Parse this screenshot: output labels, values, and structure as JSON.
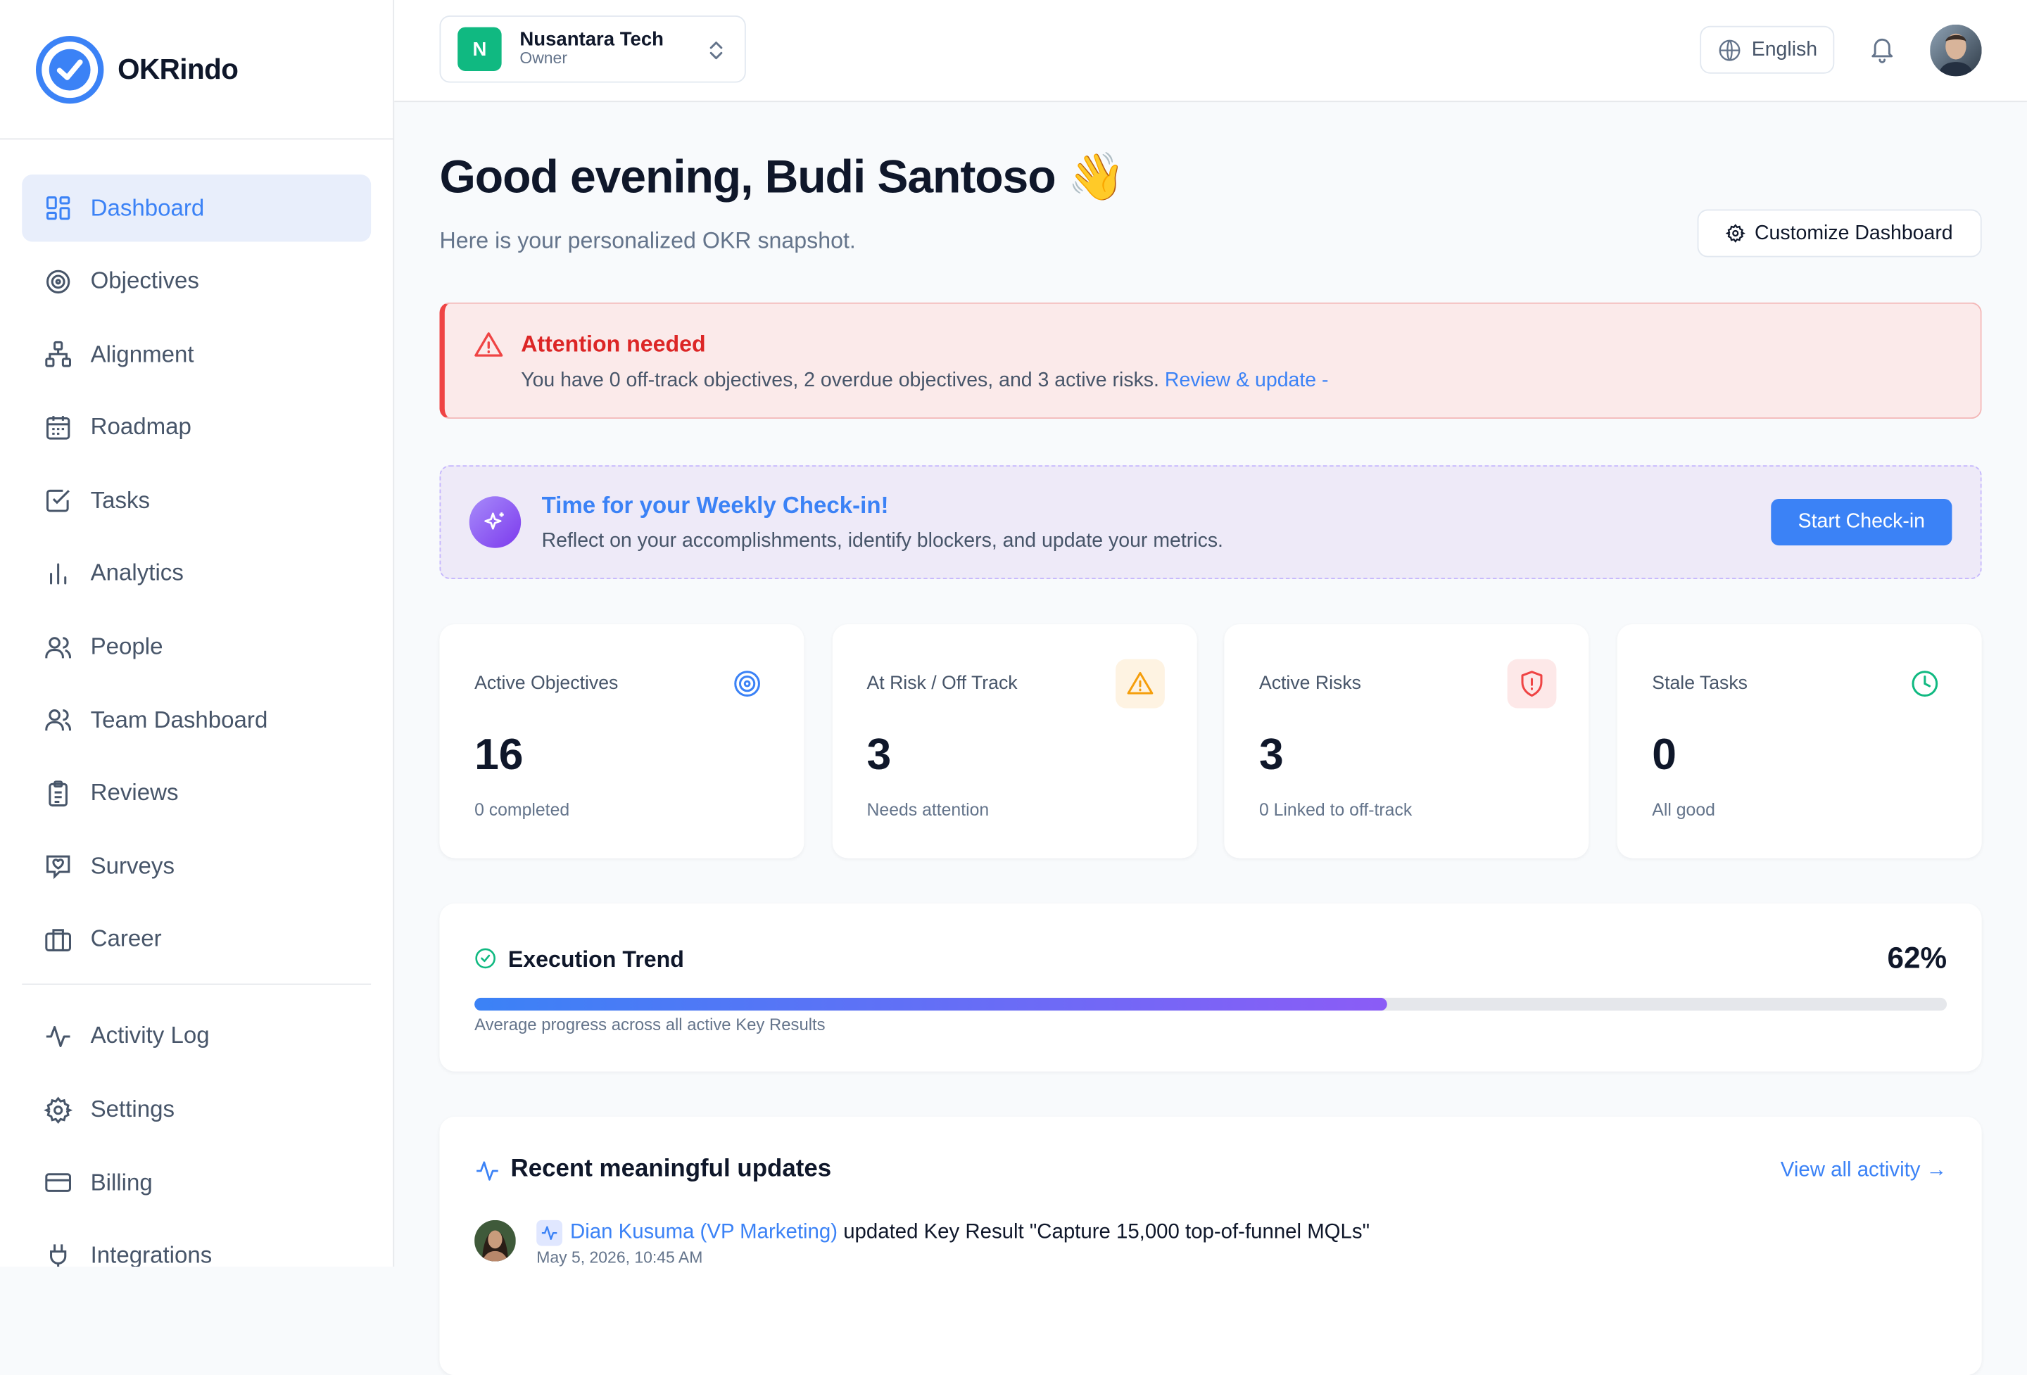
{
  "app": {
    "name": "OKRindo",
    "accent": "#3b82f6"
  },
  "sidebar": {
    "items": [
      {
        "label": "Dashboard",
        "icon": "dashboard-icon",
        "active": true
      },
      {
        "label": "Objectives",
        "icon": "target-icon"
      },
      {
        "label": "Alignment",
        "icon": "hierarchy-icon"
      },
      {
        "label": "Roadmap",
        "icon": "calendar-icon"
      },
      {
        "label": "Tasks",
        "icon": "checkbox-icon"
      },
      {
        "label": "Analytics",
        "icon": "bar-chart-icon"
      },
      {
        "label": "People",
        "icon": "users-icon"
      },
      {
        "label": "Team Dashboard",
        "icon": "users-icon"
      },
      {
        "label": "Reviews",
        "icon": "clipboard-icon"
      },
      {
        "label": "Surveys",
        "icon": "survey-icon"
      },
      {
        "label": "Career",
        "icon": "briefcase-icon"
      }
    ],
    "secondary": [
      {
        "label": "Activity Log",
        "icon": "activity-icon"
      },
      {
        "label": "Settings",
        "icon": "gear-icon"
      },
      {
        "label": "Billing",
        "icon": "credit-card-icon"
      },
      {
        "label": "Integrations",
        "icon": "plug-icon"
      }
    ]
  },
  "topbar": {
    "org": {
      "initial": "N",
      "name": "Nusantara Tech",
      "role": "Owner",
      "color": "#10b981"
    },
    "language": "English"
  },
  "header": {
    "greeting": "Good evening, Budi Santoso 👋",
    "subtitle": "Here is your personalized OKR snapshot.",
    "customize_label": "Customize Dashboard"
  },
  "alert": {
    "title": "Attention needed",
    "text": "You have 0 off-track objectives, 2 overdue objectives, and 3 active risks.",
    "link": "Review & update -"
  },
  "checkin": {
    "title": "Time for your Weekly Check-in!",
    "text": "Reflect on your accomplishments, identify blockers, and update your metrics.",
    "button": "Start Check-in"
  },
  "stats": [
    {
      "label": "Active Objectives",
      "value": "16",
      "note": "0 completed",
      "icon": "target-icon",
      "color": "#3b82f6"
    },
    {
      "label": "At Risk / Off Track",
      "value": "3",
      "note": "Needs attention",
      "icon": "warning-icon",
      "color": "#f59e0b"
    },
    {
      "label": "Active Risks",
      "value": "3",
      "note": "0 Linked to off-track",
      "icon": "shield-alert-icon",
      "color": "#ef4444"
    },
    {
      "label": "Stale Tasks",
      "value": "0",
      "note": "All good",
      "icon": "clock-icon",
      "color": "#10b981"
    }
  ],
  "trend": {
    "title": "Execution Trend",
    "percent_label": "62%",
    "progress": 0.62,
    "note": "Average progress across all active Key Results"
  },
  "recent": {
    "title": "Recent meaningful updates",
    "view_all": "View all activity →",
    "items": [
      {
        "actor": "Dian Kusuma (VP Marketing)",
        "action": "updated Key Result \"Capture 15,000 top-of-funnel MQLs\"",
        "date": "May 5, 2026, 10:45 AM"
      }
    ]
  }
}
